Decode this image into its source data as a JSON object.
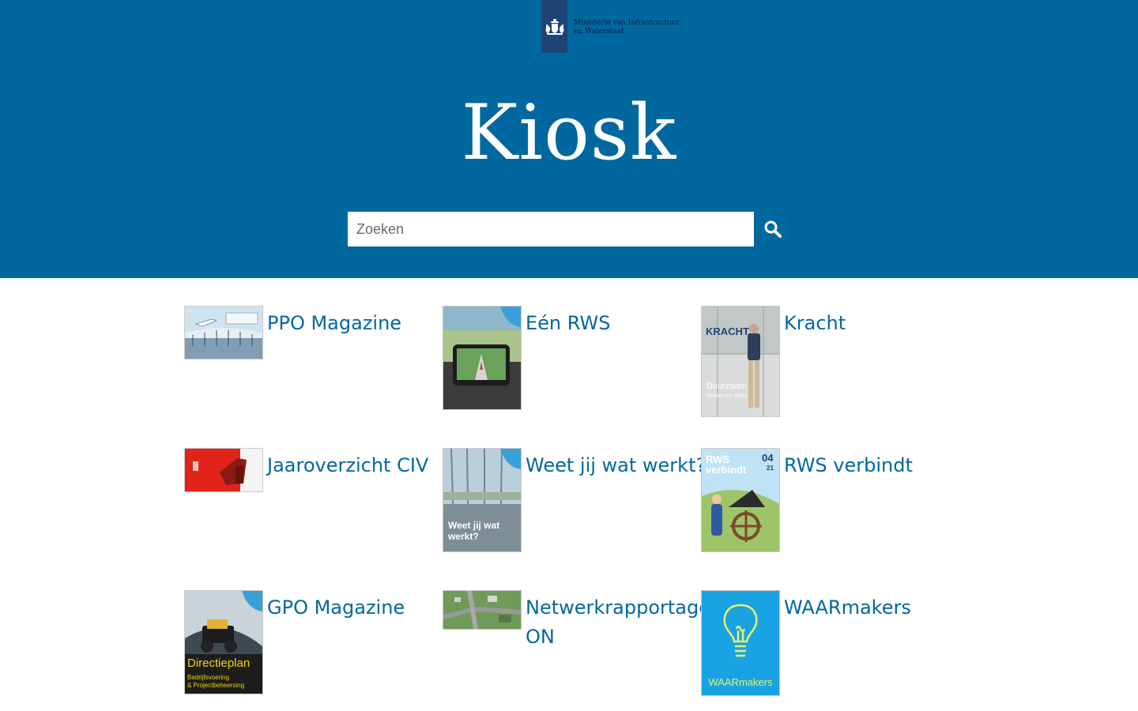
{
  "header": {
    "logo_line1": "Ministerie van Infrastructuur",
    "logo_line2": "en Waterstaat",
    "title": "Kiosk"
  },
  "search": {
    "placeholder": "Zoeken",
    "value": "",
    "button_icon": "search-icon"
  },
  "colors": {
    "brand_blue": "#00689e",
    "logo_bar": "#1e4476",
    "link": "#00689e"
  },
  "publications": [
    {
      "title": "PPO Magazine"
    },
    {
      "title": "Eén RWS"
    },
    {
      "title": "Kracht"
    },
    {
      "title": "Jaaroverzicht CIV"
    },
    {
      "title": "Weet jij wat werkt?"
    },
    {
      "title": "RWS verbindt"
    },
    {
      "title": "GPO Magazine"
    },
    {
      "title": "Netwerkrapportage ON"
    },
    {
      "title": "WAARmakers"
    }
  ],
  "cover_text": {
    "kracht_title": "KRACHT",
    "kracht_sub1": "Duurzaam",
    "kracht_sub2": "denken en doen",
    "weet_line1": "Weet jij wat",
    "weet_line2": "werkt?",
    "rws_line1": "RWS",
    "rws_line2": "verbindt",
    "rws_issue1": "04",
    "rws_issue2": "21",
    "gpo_line1": "Directieplan",
    "gpo_line2": "Bedrijfsvoering",
    "gpo_line3": "& Projectbeheersing",
    "waar_label": "WAARmakers"
  }
}
